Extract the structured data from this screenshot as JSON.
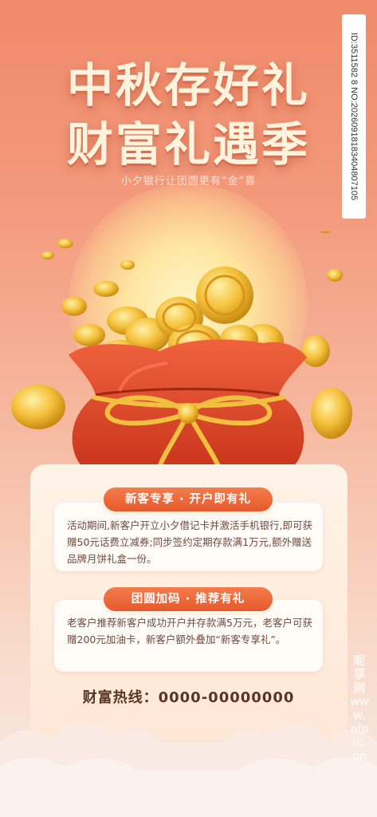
{
  "poster": {
    "title_line1": "中秋存好礼",
    "title_line2": "财富礼遇季",
    "subtitle": "小夕银行让团圆更有“金”喜"
  },
  "section1": {
    "heading": "新客专享 · 开户即有礼",
    "body": "活动期间,新客户开立小夕借记卡并激活手机银行,即可获赠50元话费立减券;同步签约定期存款满1万元,额外赠送品牌月饼礼盒一份。"
  },
  "section2": {
    "heading": "团圆加码 · 推荐有礼",
    "body": "老客户推荐新客户成功开户并存款满5万元，老客户可获赠200元加油卡，新客户额外叠加“新客专享礼”。"
  },
  "hotline": "财富热线：0000-00000000",
  "watermark": {
    "id_strip": "ID:3511582 8 NO:20260918183404807105",
    "site": "昵享网 www.nipic.cn"
  },
  "colors": {
    "background_top": "#ef8a6a",
    "title": "#fff3dd",
    "pill": "#e65a2c",
    "bag_red": "#e0452a",
    "coin_gold": "#f5c13b"
  }
}
